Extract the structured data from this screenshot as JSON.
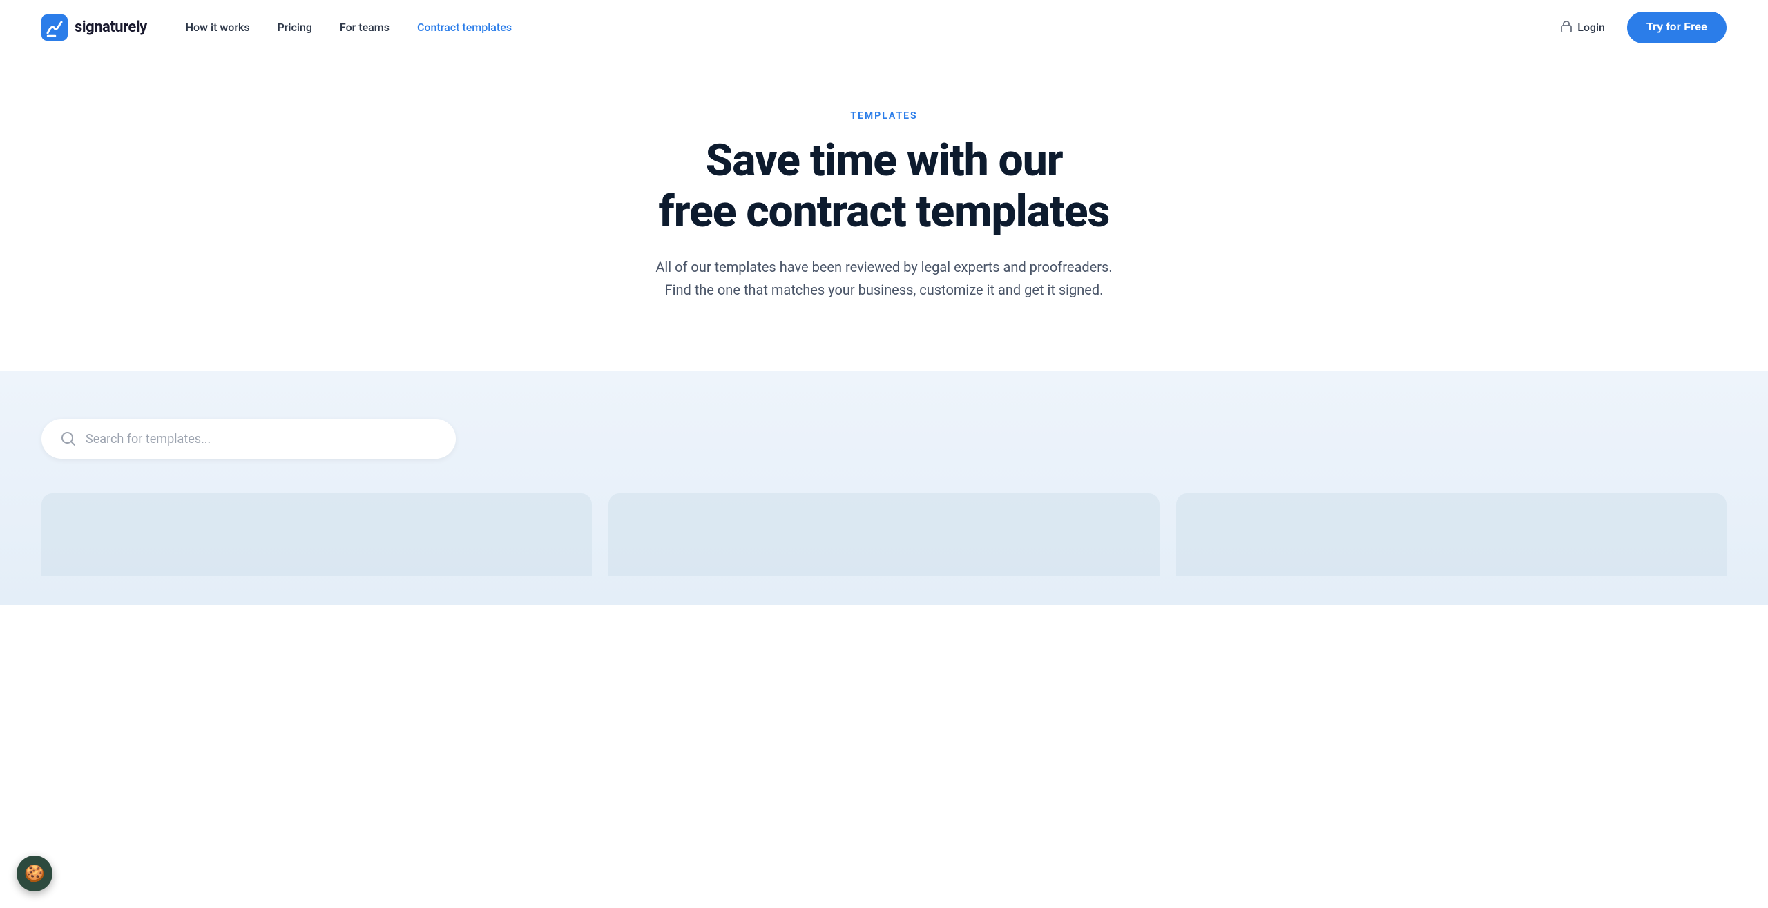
{
  "navbar": {
    "logo_text": "signaturely",
    "nav_links": [
      {
        "id": "how-it-works",
        "label": "How it works",
        "active": false
      },
      {
        "id": "pricing",
        "label": "Pricing",
        "active": false
      },
      {
        "id": "for-teams",
        "label": "For teams",
        "active": false
      },
      {
        "id": "contract-templates",
        "label": "Contract templates",
        "active": true
      }
    ],
    "login_label": "Login",
    "try_btn_label": "Try for Free"
  },
  "hero": {
    "label": "TEMPLATES",
    "title_line1": "Save time with our",
    "title_line2": "free contract templates",
    "subtitle": "All of our templates have been reviewed by legal experts and proofreaders. Find the one that matches your business, customize it and get it signed."
  },
  "search": {
    "placeholder": "Search for templates..."
  },
  "colors": {
    "brand_blue": "#2b7de9",
    "nav_active": "#2b7de9",
    "hero_title": "#0d1b2e",
    "background_section": "#eef4fb"
  }
}
